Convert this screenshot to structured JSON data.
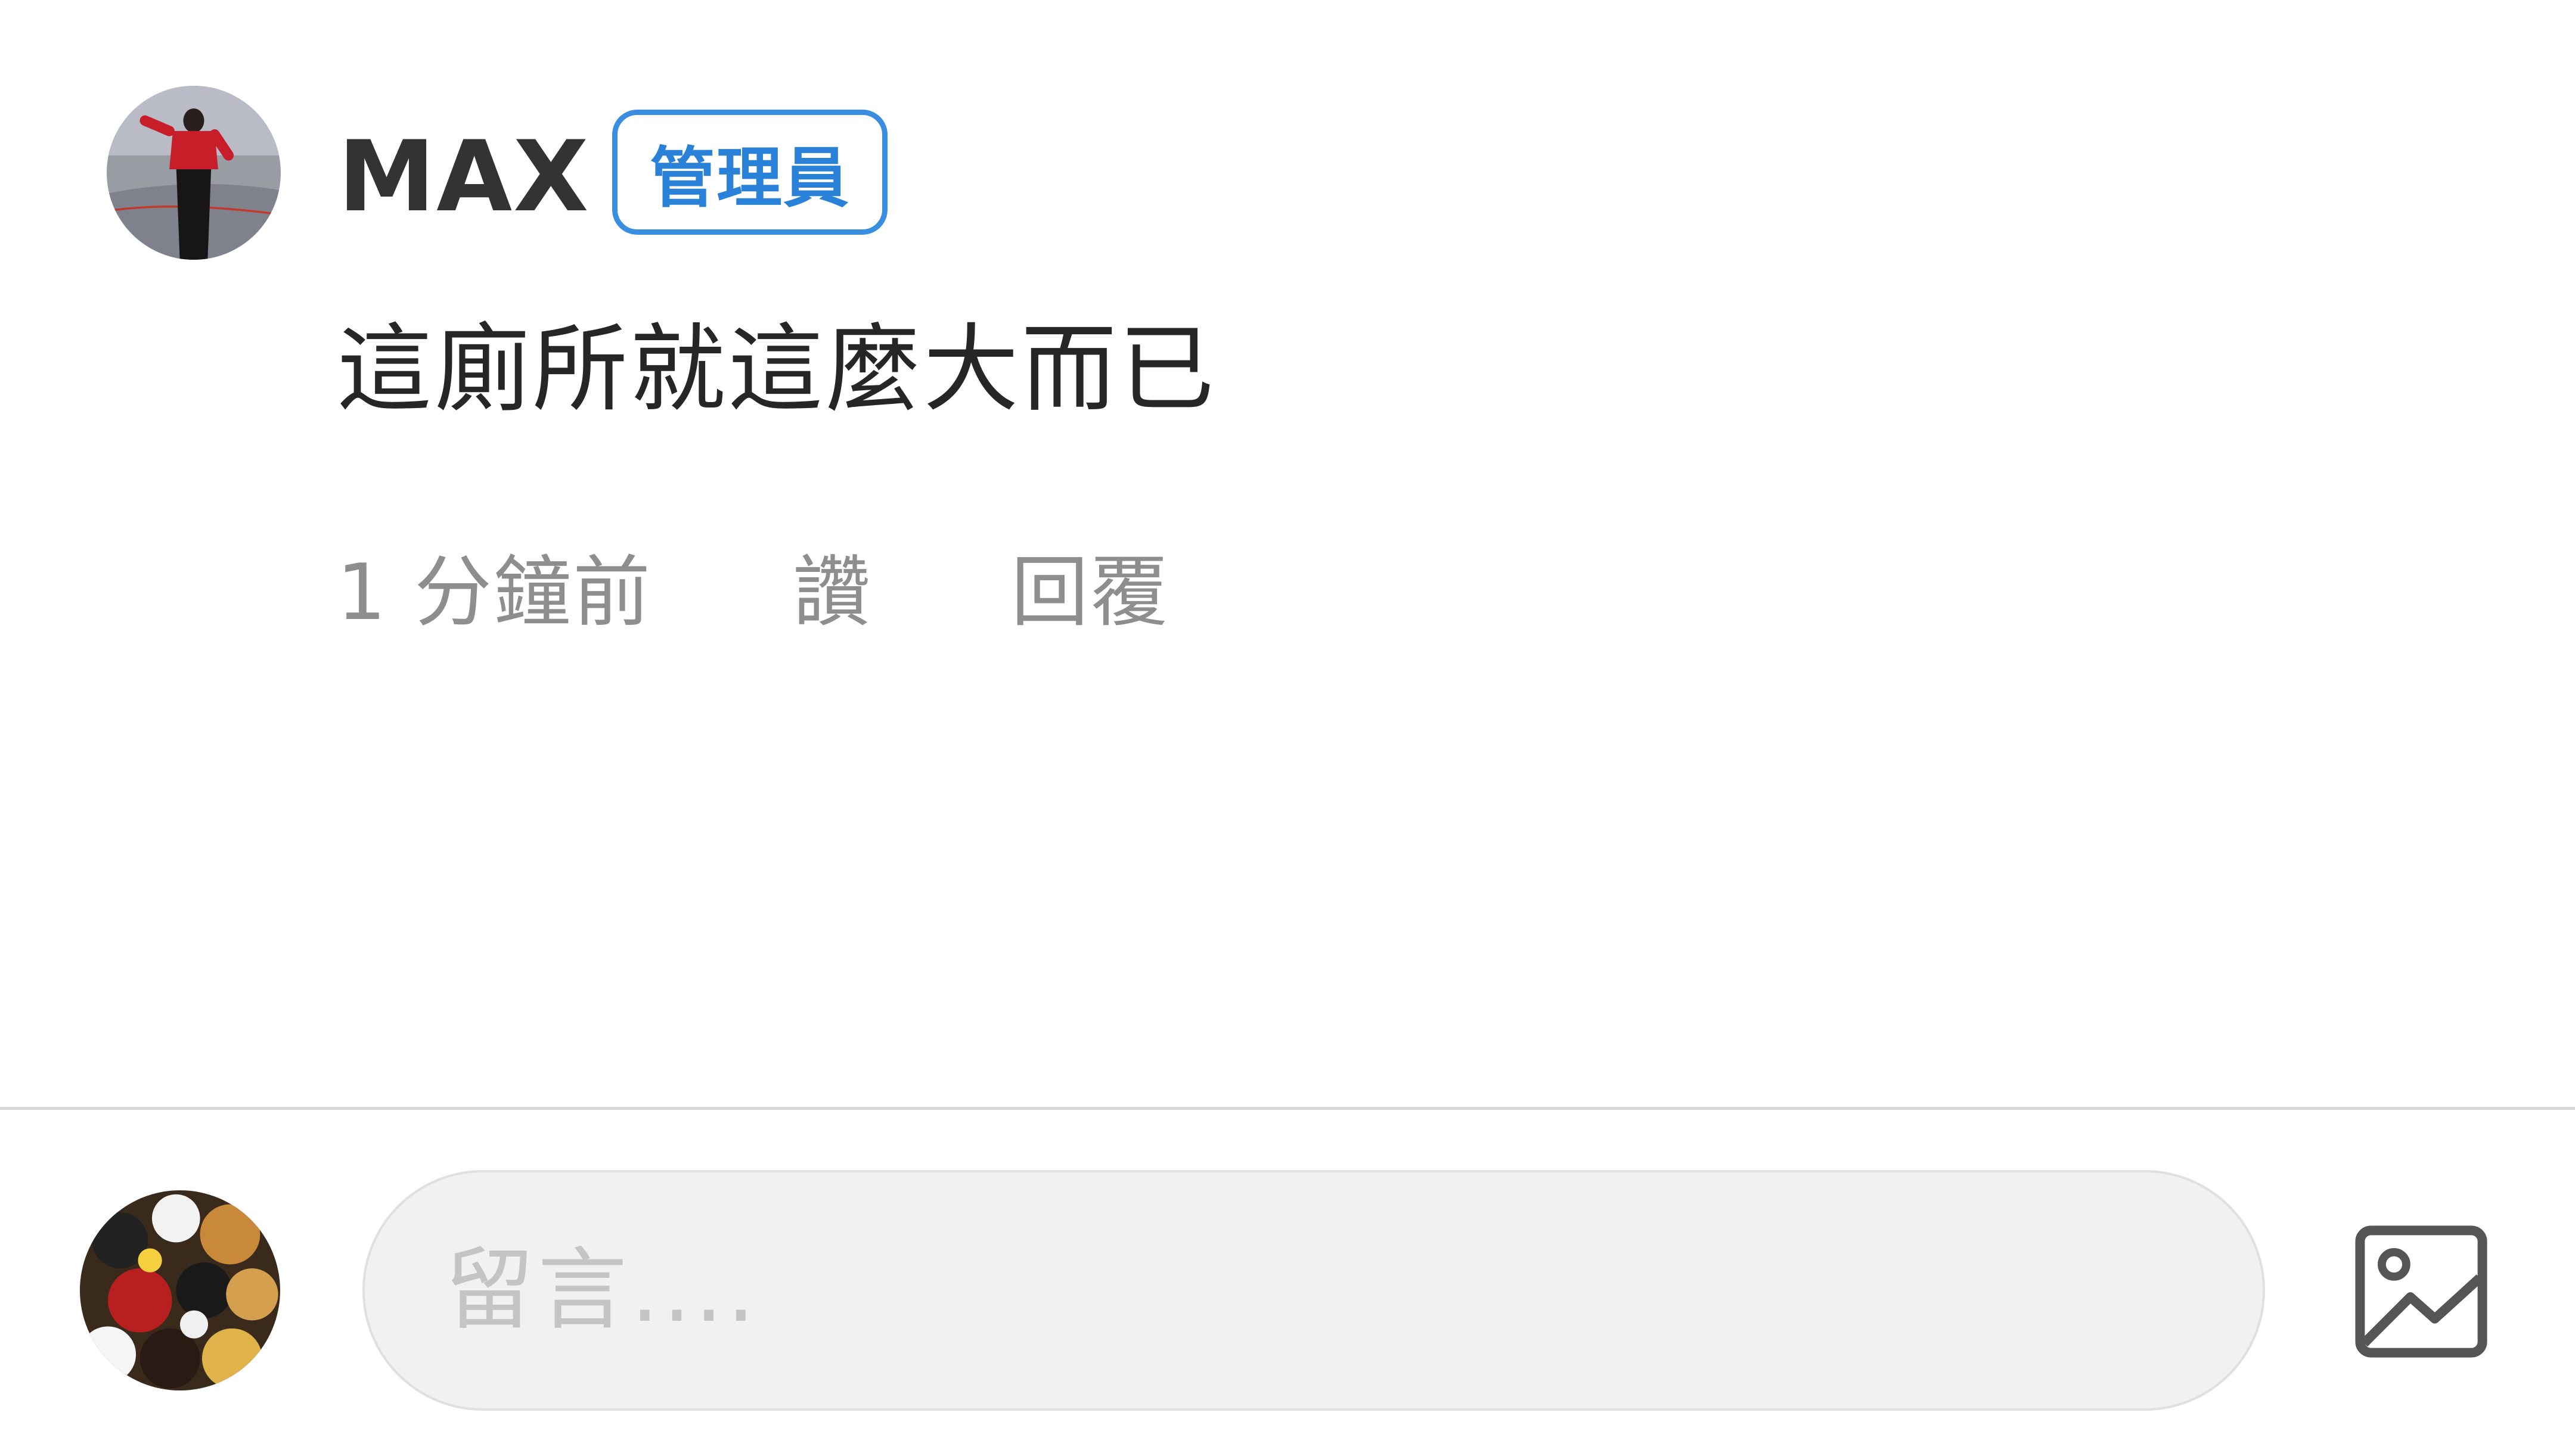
{
  "comment": {
    "author": "MAX",
    "role_badge": "管理員",
    "text": "這廁所就這麼大而已",
    "timestamp": "1 分鐘前",
    "like_label": "讚",
    "reply_label": "回覆"
  },
  "composer": {
    "placeholder": "留言....",
    "image_button_icon": "image-icon"
  },
  "colors": {
    "badge": "#3a8ee0",
    "meta_text": "#8e8e8e",
    "input_background": "#f1f1f1"
  }
}
